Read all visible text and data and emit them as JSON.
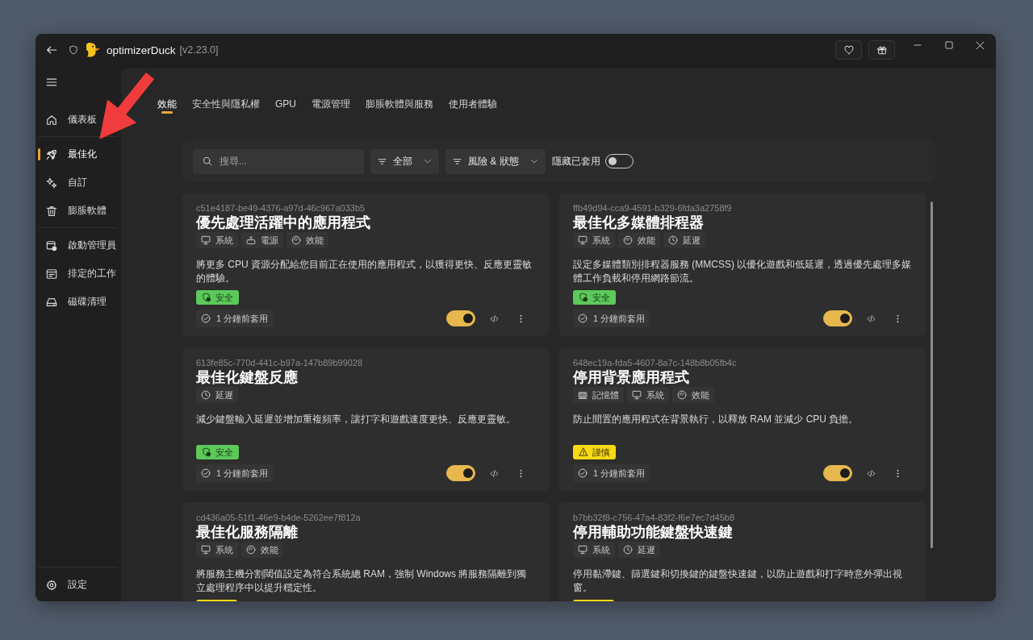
{
  "window": {
    "app_name": "optimizerDuck",
    "version": "[v2.23.0]"
  },
  "sidebar": {
    "groups": [
      {
        "items": [
          {
            "label": "儀表板",
            "selected": false
          }
        ]
      },
      {
        "items": [
          {
            "label": "最佳化",
            "selected": true
          },
          {
            "label": "自訂",
            "selected": false
          },
          {
            "label": "膨脹軟體",
            "selected": false
          }
        ]
      },
      {
        "items": [
          {
            "label": "啟動管理員",
            "selected": false
          },
          {
            "label": "排定的工作",
            "selected": false
          },
          {
            "label": "磁碟清理",
            "selected": false
          }
        ]
      }
    ],
    "footer": {
      "label": "設定",
      "selected": false
    }
  },
  "tabs": [
    {
      "label": "效能",
      "selected": true
    },
    {
      "label": "安全性與隱私權",
      "selected": false
    },
    {
      "label": "GPU",
      "selected": false
    },
    {
      "label": "電源管理",
      "selected": false
    },
    {
      "label": "膨脹軟體與服務",
      "selected": false
    },
    {
      "label": "使用者體驗",
      "selected": false
    }
  ],
  "filters": {
    "search": {
      "placeholder": "搜尋..."
    },
    "dropdowns": [
      {
        "value": "全部"
      },
      {
        "value": "風險 & 狀態"
      }
    ],
    "hide_applied": {
      "label": "隱藏已套用",
      "on": false
    }
  },
  "cards": [
    {
      "id": "c51e4187-be49-4376-a97d-46c967a033b5",
      "title": "優先處理活躍中的應用程式",
      "tags": [
        {
          "kind": "system",
          "label": "系統"
        },
        {
          "kind": "power",
          "label": "電源"
        },
        {
          "kind": "performance",
          "label": "效能"
        }
      ],
      "description": "將更多 CPU 資源分配給您目前正在使用的應用程式，以獲得更快、反應更靈敏的體驗。",
      "risk": {
        "kind": "safe",
        "label": "安全"
      },
      "applied": "1 分鐘前套用",
      "on": true
    },
    {
      "id": "ffb49d94-cca9-4591-b329-6fda3a2758f9",
      "title": "最佳化多媒體排程器",
      "tags": [
        {
          "kind": "system",
          "label": "系統"
        },
        {
          "kind": "performance",
          "label": "效能"
        },
        {
          "kind": "latency",
          "label": "延遲"
        }
      ],
      "description": "設定多媒體類別排程器服務 (MMCSS) 以優化遊戲和低延遲，透過優先處理多媒體工作負載和停用網路節流。",
      "risk": {
        "kind": "safe",
        "label": "安全"
      },
      "applied": "1 分鐘前套用",
      "on": true
    },
    {
      "id": "613fe85c-770d-441c-b97a-147b89b99028",
      "title": "最佳化鍵盤反應",
      "tags": [
        {
          "kind": "latency",
          "label": "延遲"
        }
      ],
      "description": "減少鍵盤輸入延遲並增加重複頻率，讓打字和遊戲速度更快、反應更靈敏。",
      "risk": {
        "kind": "safe",
        "label": "安全"
      },
      "applied": "1 分鐘前套用",
      "on": true
    },
    {
      "id": "648ec19a-fda5-4607-8a7c-148b8b05fb4c",
      "title": "停用背景應用程式",
      "tags": [
        {
          "kind": "memory",
          "label": "記憶體"
        },
        {
          "kind": "system",
          "label": "系統"
        },
        {
          "kind": "performance",
          "label": "效能"
        }
      ],
      "description": "防止閒置的應用程式在背景執行，以釋放 RAM 並減少 CPU 負擔。",
      "risk": {
        "kind": "caution",
        "label": "謹慎"
      },
      "applied": "1 分鐘前套用",
      "on": true
    },
    {
      "id": "cd436a05-51f1-46e9-b4de-5262ee7f812a",
      "title": "最佳化服務隔離",
      "tags": [
        {
          "kind": "system",
          "label": "系統"
        },
        {
          "kind": "performance",
          "label": "效能"
        }
      ],
      "description": "將服務主機分割閾值設定為符合系統總 RAM，強制 Windows 將服務隔離到獨立處理程序中以提升穩定性。",
      "risk": {
        "kind": "caution"
      }
    },
    {
      "id": "b7bb32f8-c756-47a4-83f2-f6e7ec7d45b8",
      "title": "停用輔助功能鍵盤快速鍵",
      "tags": [
        {
          "kind": "system",
          "label": "系統"
        },
        {
          "kind": "latency",
          "label": "延遲"
        }
      ],
      "description": "停用黏滯鍵、篩選鍵和切換鍵的鍵盤快速鍵，以防止遊戲和打字時意外彈出視窗。",
      "risk": {
        "kind": "caution"
      }
    }
  ]
}
